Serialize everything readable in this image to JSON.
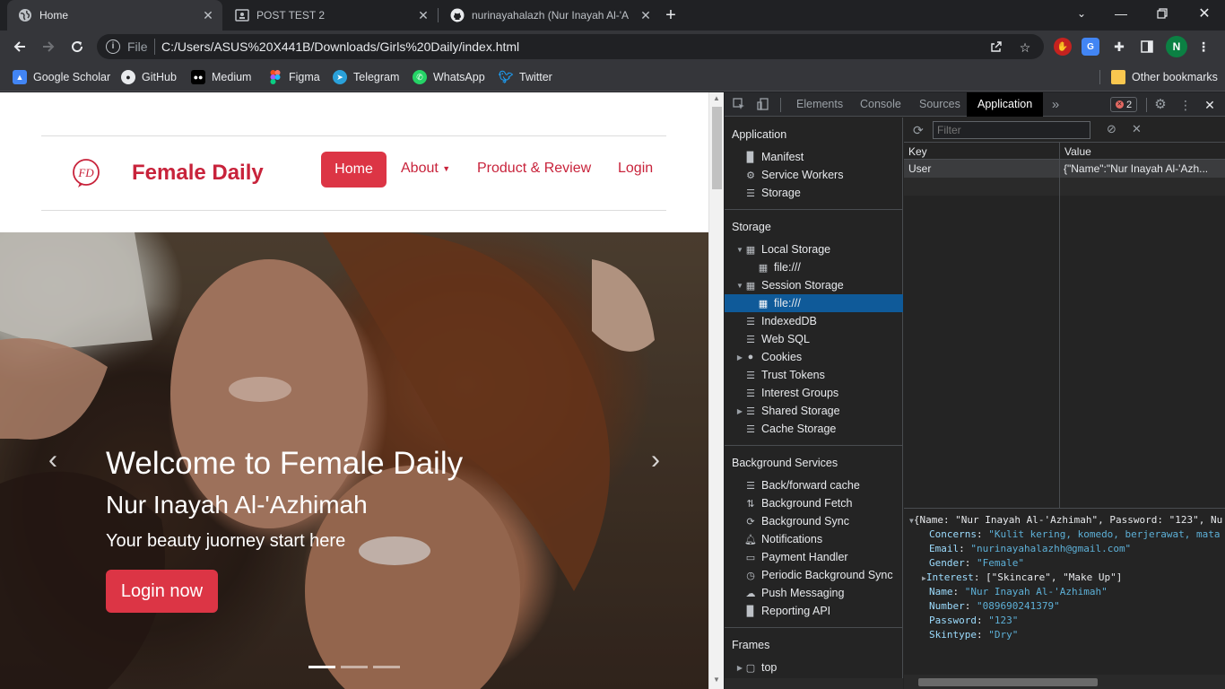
{
  "browser": {
    "tabs": [
      {
        "title": "Home",
        "active": true
      },
      {
        "title": "POST TEST 2",
        "active": false
      },
      {
        "title": "nurinayahalazh (Nur Inayah Al-'A",
        "active": false
      }
    ],
    "address": {
      "scheme_label": "File",
      "url": "C:/Users/ASUS%20X441B/Downloads/Girls%20Daily/index.html"
    },
    "profile_initial": "N",
    "bookmarks": [
      {
        "label": "Google Scholar",
        "icon": "google-scholar-icon"
      },
      {
        "label": "GitHub",
        "icon": "github-icon"
      },
      {
        "label": "Medium",
        "icon": "medium-icon"
      },
      {
        "label": "Figma",
        "icon": "figma-icon"
      },
      {
        "label": "Telegram",
        "icon": "telegram-icon"
      },
      {
        "label": "WhatsApp",
        "icon": "whatsapp-icon"
      },
      {
        "label": "Twitter",
        "icon": "twitter-icon"
      }
    ],
    "other_bookmarks": "Other bookmarks"
  },
  "site": {
    "logo_text": "FD",
    "brand": "Female Daily",
    "nav": {
      "home": "Home",
      "about": "About",
      "product": "Product & Review",
      "login": "Login"
    },
    "hero": {
      "title": "Welcome to Female Daily",
      "name": "Nur Inayah Al-'Azhimah",
      "tagline": "Your beauty juorney start here",
      "button": "Login now"
    },
    "accent": "#dc3545"
  },
  "devtools": {
    "tabs": [
      "Elements",
      "Console",
      "Sources",
      "Application"
    ],
    "active_tab": "Application",
    "error_count": "2",
    "sections": {
      "application": "Application",
      "storage": "Storage",
      "background": "Background Services",
      "frames": "Frames"
    },
    "app_items": [
      "Manifest",
      "Service Workers",
      "Storage"
    ],
    "storage_items": {
      "local": "Local Storage",
      "local_child": "file:///",
      "session": "Session Storage",
      "session_child": "file:///",
      "indexeddb": "IndexedDB",
      "websql": "Web SQL",
      "cookies": "Cookies",
      "trust": "Trust Tokens",
      "interest": "Interest Groups",
      "shared": "Shared Storage",
      "cache": "Cache Storage"
    },
    "bg_items": [
      "Back/forward cache",
      "Background Fetch",
      "Background Sync",
      "Notifications",
      "Payment Handler",
      "Periodic Background Sync",
      "Push Messaging",
      "Reporting API"
    ],
    "frames_item": "top",
    "filter_placeholder": "Filter",
    "table": {
      "headers": {
        "key": "Key",
        "value": "Value"
      },
      "row": {
        "key": "User",
        "value": "{\"Name\":\"Nur Inayah Al-'Azh..."
      }
    },
    "preview": {
      "summary": "{Name: \"Nur Inayah Al-'Azhimah\", Password: \"123\", Nu",
      "fields": [
        {
          "k": "Concerns",
          "v": "\"Kulit kering, komedo, berjerawat, mata"
        },
        {
          "k": "Email",
          "v": "\"nurinayahalazhh@gmail.com\""
        },
        {
          "k": "Gender",
          "v": "\"Female\""
        },
        {
          "k": "Interest",
          "v": "[\"Skincare\", \"Make Up\"]"
        },
        {
          "k": "Name",
          "v": "\"Nur Inayah Al-'Azhimah\""
        },
        {
          "k": "Number",
          "v": "\"089690241379\""
        },
        {
          "k": "Password",
          "v": "\"123\""
        },
        {
          "k": "Skintype",
          "v": "\"Dry\""
        }
      ]
    }
  }
}
